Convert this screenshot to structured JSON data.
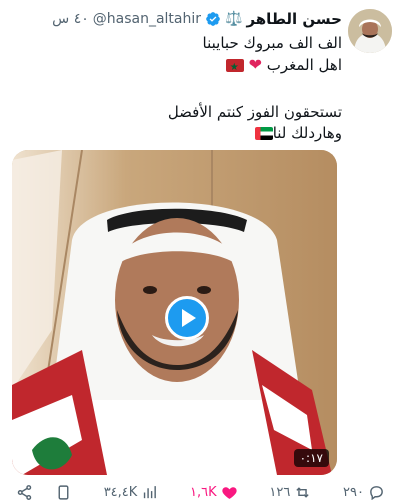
{
  "author": {
    "name": "حسن الطاهر",
    "badge_glyph": "⚖️",
    "handle": "@hasan_altahir",
    "time": "٤٠ س"
  },
  "tweet": {
    "line1": "الف الف مبروك حبايبنا",
    "line2": "اهل المغرب",
    "line3": "تستحقون الفوز كنتم الأفضل",
    "line4": "وهاردلك لنا"
  },
  "media": {
    "duration": "٠:١٧"
  },
  "actions": {
    "share_label": "",
    "views": "٣٤,٤K",
    "likes": "١,٦K",
    "retweets": "١٢٦",
    "replies": "٢٩٠"
  },
  "colors": {
    "accent": "#1d9bf0",
    "like": "#f91880",
    "muted": "#536471"
  }
}
